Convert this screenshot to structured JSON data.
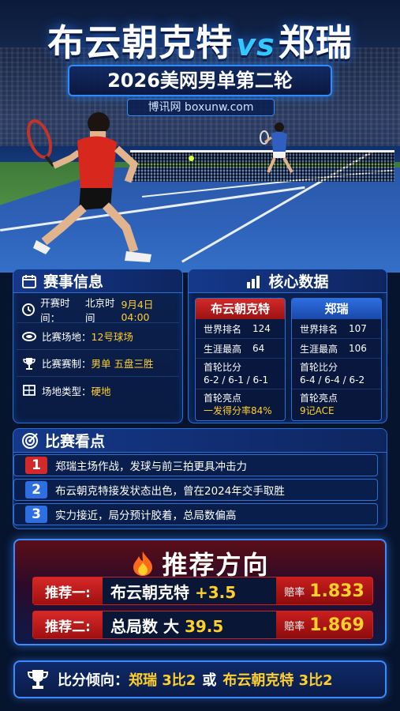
{
  "header": {
    "player_a": "布云朝克特",
    "vs": "vs",
    "player_b": "郑瑞",
    "subtitle": "2026美网男单第二轮",
    "site": "博讯网 boxunw.com"
  },
  "match_info": {
    "title": "赛事信息",
    "rows": [
      {
        "icon": "clock-icon",
        "label": "开赛时间：",
        "prefix": "北京时间 ",
        "value": "9月4日 04:00"
      },
      {
        "icon": "stadium-icon",
        "label": "比赛场地：",
        "prefix": "",
        "value": "12号球场"
      },
      {
        "icon": "trophy-icon",
        "label": "比赛赛制：",
        "prefix": "",
        "value": "男单 五盘三胜"
      },
      {
        "icon": "court-icon",
        "label": "场地类型：",
        "prefix": "",
        "value": "硬地"
      }
    ]
  },
  "core_data": {
    "title": "核心数据",
    "player_a": {
      "name": "布云朝克特",
      "rank_label": "世界排名",
      "rank": "124",
      "best_label": "生涯最高",
      "best": "64",
      "first_round_label": "首轮比分",
      "first_round": "6-2 / 6-1 / 6-1",
      "highlight_label": "首轮亮点",
      "highlight": "一发得分率84%"
    },
    "player_b": {
      "name": "郑瑞",
      "rank_label": "世界排名",
      "rank": "107",
      "best_label": "生涯最高",
      "best": "106",
      "first_round_label": "首轮比分",
      "first_round": "6-4 / 6-4 / 6-2",
      "highlight_label": "首轮亮点",
      "highlight": "9记ACE"
    }
  },
  "highlights": {
    "title": "比赛看点",
    "items": [
      {
        "num": "1",
        "text": "郑瑞主场作战，发球与前三拍更具冲击力"
      },
      {
        "num": "2",
        "text": "布云朝克特接发状态出色，曾在2024年交手取胜"
      },
      {
        "num": "3",
        "text": "实力接近，局分预计胶着，总局数偏高"
      }
    ]
  },
  "recommendation": {
    "title": "推荐方向",
    "items": [
      {
        "label": "推荐一:",
        "pick_name": "布云朝克特 ",
        "pick_value": "+3.5",
        "odds_label": "赔率",
        "odds": "1.833"
      },
      {
        "label": "推荐二:",
        "pick_name": "总局数 大 ",
        "pick_value": "39.5",
        "odds_label": "赔率",
        "odds": "1.869"
      }
    ]
  },
  "score_trend": {
    "label": "比分倾向：",
    "option_a": "郑瑞 3比2",
    "or": "或",
    "option_b": "布云朝克特 3比2"
  },
  "colors": {
    "accent_yellow": "#ffd02a",
    "accent_blue": "#2f8cff",
    "red": "#cc2222"
  }
}
